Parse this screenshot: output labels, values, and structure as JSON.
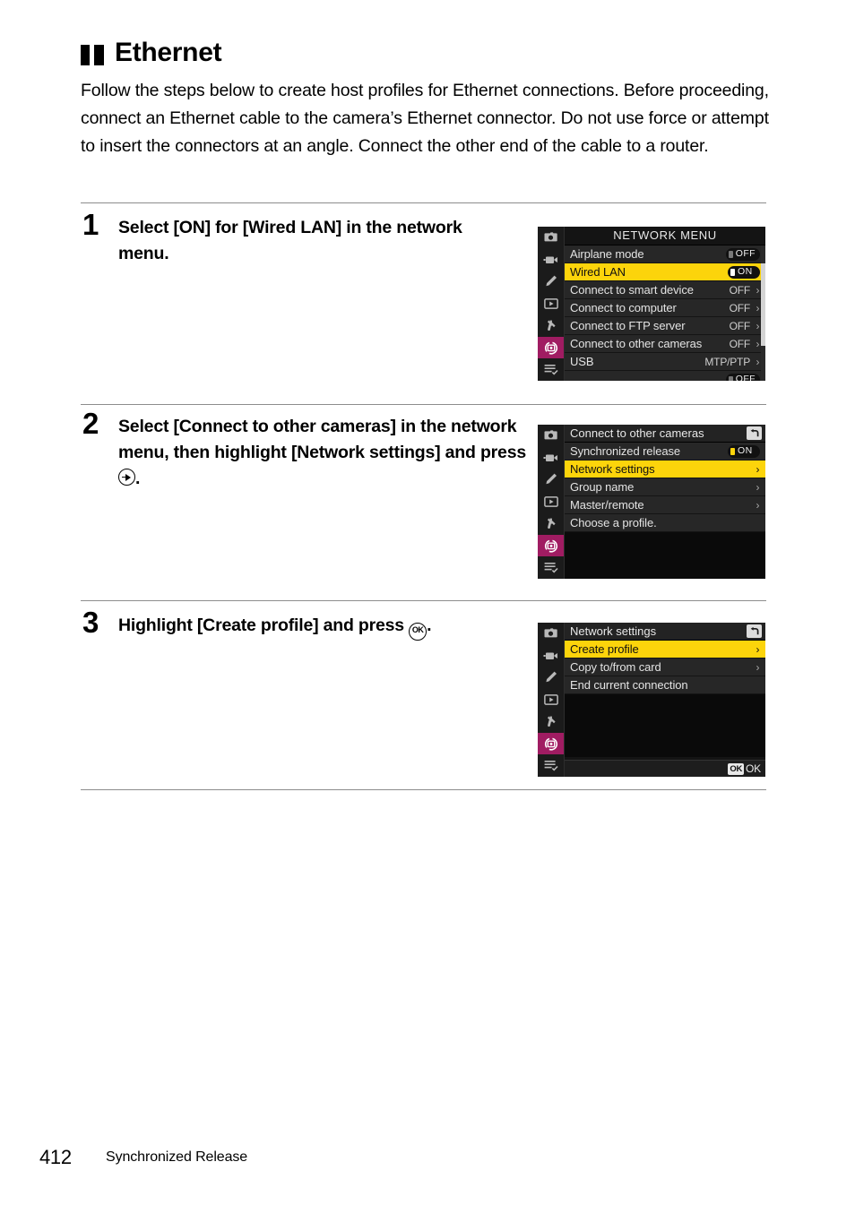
{
  "heading": {
    "mark": "black-bars-icon",
    "title": "Ethernet"
  },
  "intro": "Follow the steps below to create host profiles for Ethernet connections. Before proceeding, connect an Ethernet cable to the camera’s Ethernet connector. Do not use force or attempt to insert the connectors at an angle. Connect the other end of the cable to a router.",
  "steps": [
    {
      "number": "1",
      "text_before": "Select [ON] for [Wired LAN] in the network menu.",
      "glyph": "",
      "text_after": ""
    },
    {
      "number": "2",
      "text_before": "Select [Connect to other cameras] in the network menu, then highlight [Network settings] and press ",
      "glyph": "multi-selector-right-icon",
      "text_after": "."
    },
    {
      "number": "3",
      "text_before": "Highlight [Create profile] and press ",
      "glyph": "ok-button-icon",
      "text_after": "."
    }
  ],
  "screens": [
    {
      "id": "network-menu",
      "title": "NETWORK MENU",
      "title_align": "center",
      "back_icon": false,
      "scrollbar": true,
      "tabs": [
        "photo-shooting-menu-icon",
        "movie-shooting-menu-icon",
        "custom-settings-menu-icon",
        "playback-menu-icon",
        "setup-menu-icon",
        "network-menu-icon",
        "my-menu-icon"
      ],
      "active_tab_index": 5,
      "rows": [
        {
          "label": "Airplane mode",
          "toggle": "OFF",
          "knob": "off",
          "highlight": false
        },
        {
          "label": "Wired LAN",
          "toggle": "ON",
          "knob": "on",
          "highlight": true
        },
        {
          "label": "Connect to smart device",
          "value": "OFF",
          "chevron": true,
          "highlight": false
        },
        {
          "label": "Connect to computer",
          "value": "OFF",
          "chevron": true,
          "highlight": false
        },
        {
          "label": "Connect to FTP server",
          "value": "OFF",
          "chevron": true,
          "highlight": false
        },
        {
          "label": "Connect to other cameras",
          "value": "OFF",
          "chevron": true,
          "highlight": false
        },
        {
          "label": "USB",
          "value": "MTP/PTP",
          "chevron": true,
          "highlight": false
        },
        {
          "label": "",
          "value": "",
          "chevron": false,
          "highlight": false,
          "clipped": true
        }
      ]
    },
    {
      "id": "connect-to-other-cameras",
      "title": "Connect to other cameras",
      "title_align": "left",
      "back_icon": true,
      "scrollbar": false,
      "tabs": [
        "photo-shooting-menu-icon",
        "movie-shooting-menu-icon",
        "custom-settings-menu-icon",
        "playback-menu-icon",
        "setup-menu-icon",
        "network-menu-icon",
        "my-menu-icon"
      ],
      "active_tab_index": 5,
      "rows": [
        {
          "label": "Synchronized release",
          "toggle": "ON",
          "knob": "onyellow",
          "highlight": false
        },
        {
          "label": "Network settings",
          "chevron": true,
          "highlight": true
        },
        {
          "label": "Group name",
          "chevron": true,
          "highlight": false
        },
        {
          "label": "Master/remote",
          "chevron": true,
          "highlight": false
        },
        {
          "label": "Choose a profile.",
          "chevron": false,
          "highlight": false,
          "hint": true
        }
      ]
    },
    {
      "id": "network-settings",
      "title": "Network settings",
      "title_align": "left",
      "back_icon": true,
      "scrollbar": false,
      "footer_ok": "OK",
      "tabs": [
        "photo-shooting-menu-icon",
        "movie-shooting-menu-icon",
        "custom-settings-menu-icon",
        "playback-menu-icon",
        "setup-menu-icon",
        "network-menu-icon",
        "my-menu-icon"
      ],
      "active_tab_index": 5,
      "rows": [
        {
          "label": "Create profile",
          "chevron": true,
          "highlight": true
        },
        {
          "label": "Copy to/from card",
          "chevron": true,
          "highlight": false
        },
        {
          "label": "End current connection",
          "chevron": false,
          "highlight": false
        }
      ]
    }
  ],
  "footer": {
    "page_number": "412",
    "chapter": "Synchronized Release"
  },
  "colors": {
    "highlight_yellow": "#fcd40b",
    "tab_active_magenta": "#a01c62",
    "lcd_background": "#141414",
    "rule_gray": "#8d8d8d"
  }
}
